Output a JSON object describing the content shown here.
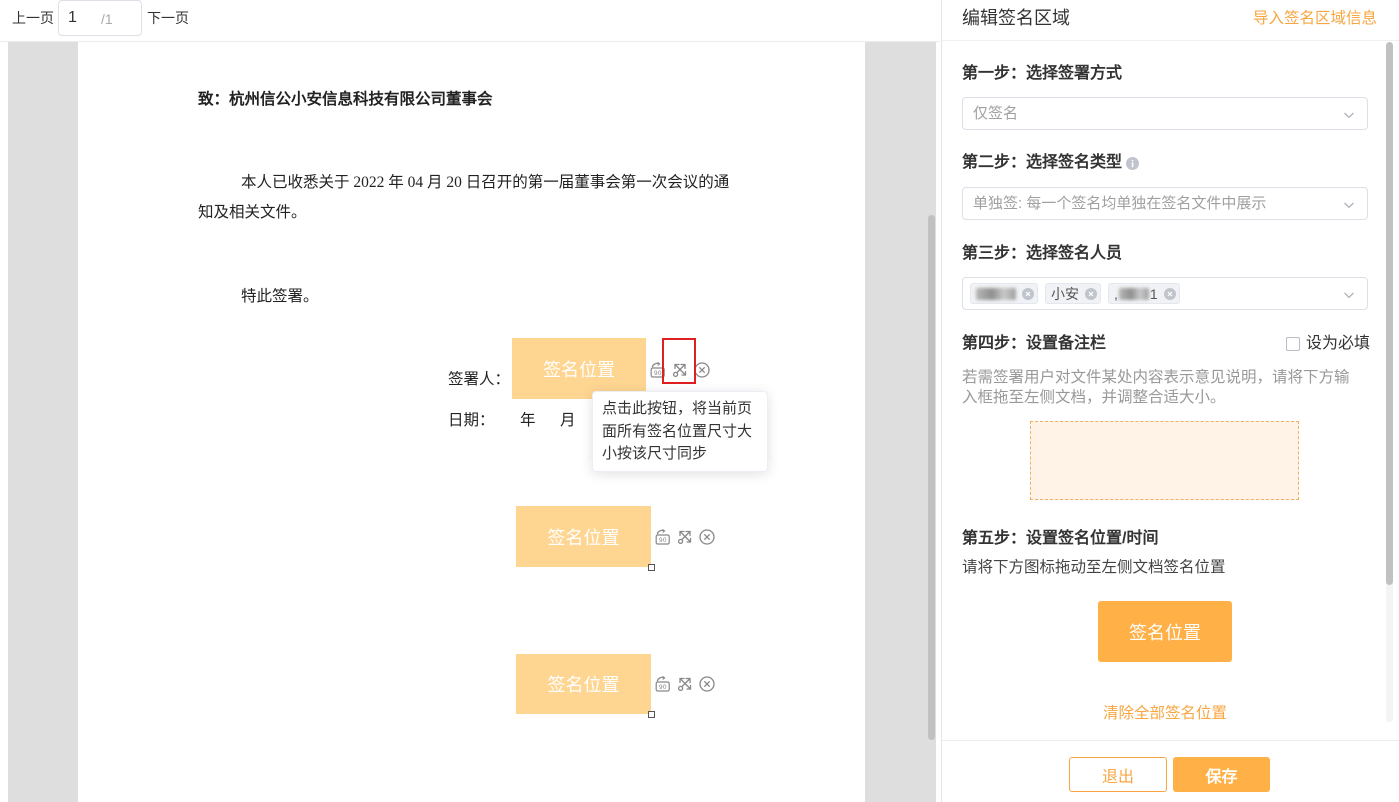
{
  "toolbar": {
    "prev_label": "上一页",
    "page_value": "1",
    "page_total": "/1",
    "next_label": "下一页"
  },
  "document": {
    "addressee": "致：杭州信公小安信息科技有限公司董事会",
    "paragraph_line1": "本人已收悉关于 2022 年 04 月 20 日召开的第一届董事会第一次会议的通",
    "paragraph_line2": "知及相关文件。",
    "closing": "特此签署。",
    "signer_label": "签署人：",
    "date_label": "日期：",
    "year_label": "年",
    "month_label": "月"
  },
  "signature_boxes": [
    {
      "label": "签名位置"
    },
    {
      "label": "签名位置"
    },
    {
      "label": "签名位置"
    }
  ],
  "rotate_badge": "90",
  "tooltip": {
    "lines": [
      "点击此按钮，将当前页",
      "面所有签名位置尺寸大",
      "小按该尺寸同步"
    ]
  },
  "panel": {
    "title": "编辑签名区域",
    "import_link": "导入签名区域信息",
    "step1": {
      "title": "第一步：选择签署方式",
      "value": "仅签名"
    },
    "step2": {
      "title": "第二步：选择签名类型",
      "value": "单独签: 每一个签名均单独在签名文件中展示"
    },
    "step3": {
      "title": "第三步：选择签名人员",
      "tags": [
        {
          "masked": true
        },
        {
          "label": "小安"
        },
        {
          "prefix": ",",
          "masked": true,
          "suffix": "1"
        }
      ]
    },
    "step4": {
      "title": "第四步：设置备注栏",
      "required_label": "设为必填",
      "required_checked": false,
      "description_line1": "若需签署用户对文件某处内容表示意见说明，请将下方输",
      "description_line2": "入框拖至左侧文档，并调整合适大小。"
    },
    "step5": {
      "title": "第五步：设置签名位置/时间",
      "hint": "请将下方图标拖动至左侧文档签名位置",
      "signature_button": "签名位置",
      "clear_link": "清除全部签名位置"
    },
    "footer": {
      "exit_label": "退出",
      "save_label": "保存"
    }
  },
  "colors": {
    "accent": "#f7a640",
    "accent_button": "#ffb046",
    "signature_box": "#ffd592",
    "highlight": "#e02020"
  }
}
